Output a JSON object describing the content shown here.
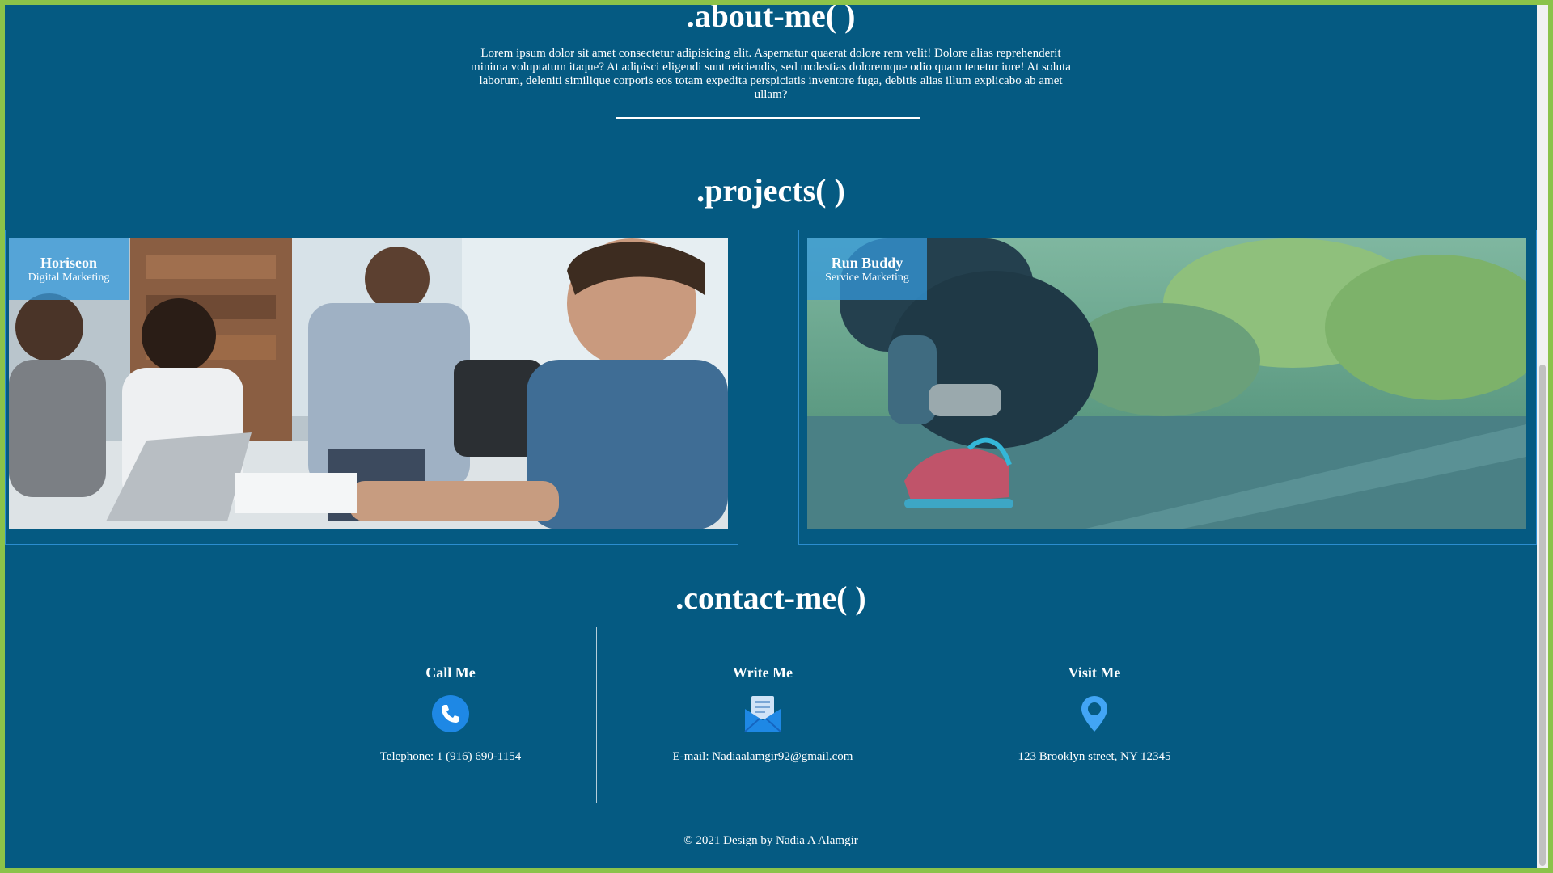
{
  "about": {
    "title": ".about-me( )",
    "text": "Lorem ipsum dolor sit amet consectetur adipisicing elit. Aspernatur quaerat dolore rem velit! Dolore alias reprehenderit minima voluptatum itaque? At adipisci eligendi sunt reiciendis, sed molestias doloremque odio quam tenetur iure! At soluta laborum, deleniti similique corporis eos totam expedita perspiciatis inventore fuga, debitis alias illum explicabo ab amet ullam?"
  },
  "projects": {
    "title": ".projects( )",
    "items": [
      {
        "name": "Horiseon",
        "subtitle": "Digital Marketing",
        "image_icon": "office-meeting-photo"
      },
      {
        "name": "Run Buddy",
        "subtitle": "Service Marketing",
        "image_icon": "runner-tying-shoe-photo"
      }
    ]
  },
  "contact": {
    "title": ".contact-me( )",
    "columns": [
      {
        "heading": "Call Me",
        "icon": "phone-icon",
        "text": "Telephone: 1 (916) 690-1154"
      },
      {
        "heading": "Write Me",
        "icon": "envelope-icon",
        "text": "E-mail: Nadiaalamgir92@gmail.com"
      },
      {
        "heading": "Visit Me",
        "icon": "location-pin-icon",
        "text": "123 Brooklyn street, NY 12345"
      }
    ]
  },
  "footer": {
    "text": "© 2021 Design by Nadia A Alamgir"
  },
  "colors": {
    "page_background": "#055a82",
    "frame": "#8bc34a",
    "accent_blue": "#3498db",
    "icon_blue": "#1e88e5"
  }
}
